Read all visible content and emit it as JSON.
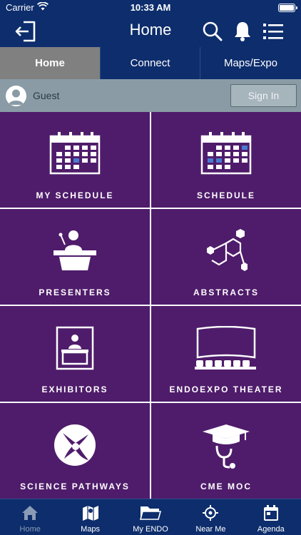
{
  "status": {
    "carrier": "Carrier",
    "time": "10:33 AM"
  },
  "nav": {
    "title": "Home"
  },
  "tabs": [
    {
      "label": "Home",
      "active": true
    },
    {
      "label": "Connect",
      "active": false
    },
    {
      "label": "Maps/Expo",
      "active": false
    }
  ],
  "user": {
    "name": "Guest",
    "sign_in_label": "Sign In"
  },
  "tiles": [
    {
      "label": "MY SCHEDULE",
      "icon": "calendar-icon"
    },
    {
      "label": "SCHEDULE",
      "icon": "calendar-icon"
    },
    {
      "label": "PRESENTERS",
      "icon": "podium-speaker-icon"
    },
    {
      "label": "ABSTRACTS",
      "icon": "molecule-icon"
    },
    {
      "label": "EXHIBITORS",
      "icon": "exhibitor-booth-icon"
    },
    {
      "label": "ENDOEXPO THEATER",
      "icon": "theater-icon"
    },
    {
      "label": "SCIENCE PATHWAYS",
      "icon": "cell-icon"
    },
    {
      "label": "CME MOC",
      "icon": "graduation-stethoscope-icon"
    }
  ],
  "tabbar": [
    {
      "label": "Home",
      "icon": "home-icon",
      "active": true
    },
    {
      "label": "Maps",
      "icon": "map-icon",
      "active": false
    },
    {
      "label": "My ENDO",
      "icon": "folder-icon",
      "active": false
    },
    {
      "label": "Near Me",
      "icon": "crosshair-icon",
      "active": false
    },
    {
      "label": "Agenda",
      "icon": "agenda-calendar-icon",
      "active": false
    }
  ],
  "colors": {
    "navy": "#0d2d6c",
    "purple": "#4f1c6b",
    "tab_active": "#808080",
    "user_bar": "#8a9ba6",
    "calendar_highlight": "#4a7bd0"
  }
}
